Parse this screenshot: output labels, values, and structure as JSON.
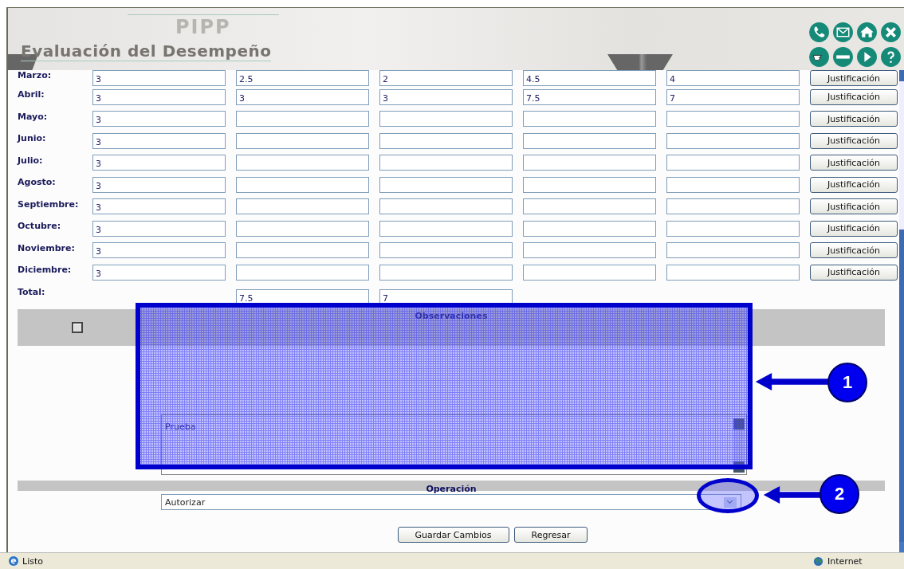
{
  "header": {
    "title": "Evaluación del Desempeño",
    "logo_text": "PIPP"
  },
  "months": [
    {
      "label": "Marzo:",
      "cells": [
        {
          "value": "3"
        },
        {
          "value": "2.5"
        },
        {
          "value": "2"
        },
        {
          "value": "4.5"
        },
        {
          "value": "4"
        }
      ],
      "button": "Justificación"
    },
    {
      "label": "Abril:",
      "cells": [
        {
          "value": "3"
        },
        {
          "value": "3"
        },
        {
          "value": "3"
        },
        {
          "value": "7.5"
        },
        {
          "value": "7"
        }
      ],
      "button": "Justificación"
    },
    {
      "label": "Mayo:",
      "cells": [
        {
          "value": "3"
        },
        {},
        {},
        {},
        {}
      ],
      "button": "Justificación"
    },
    {
      "label": "Junio:",
      "cells": [
        {
          "value": "3"
        },
        {},
        {},
        {},
        {}
      ],
      "button": "Justificación"
    },
    {
      "label": "Julio:",
      "cells": [
        {
          "value": "3"
        },
        {},
        {},
        {},
        {}
      ],
      "button": "Justificación"
    },
    {
      "label": "Agosto:",
      "cells": [
        {
          "value": "3"
        },
        {},
        {},
        {},
        {}
      ],
      "button": "Justificación"
    },
    {
      "label": "Septiembre:",
      "cells": [
        {
          "value": "3"
        },
        {},
        {},
        {},
        {}
      ],
      "button": "Justificación"
    },
    {
      "label": "Octubre:",
      "cells": [
        {
          "value": "3"
        },
        {},
        {},
        {},
        {}
      ],
      "button": "Justificación"
    },
    {
      "label": "Noviembre:",
      "cells": [
        {
          "value": "3"
        },
        {},
        {},
        {},
        {}
      ],
      "button": "Justificación"
    },
    {
      "label": "Diciembre:",
      "cells": [
        {
          "value": "3"
        },
        {},
        {},
        {},
        {}
      ],
      "button": "Justificación"
    }
  ],
  "total": {
    "label": "Total:",
    "cells": [
      {
        "kind": "blank"
      },
      {
        "kind": "field",
        "value": "7.5"
      },
      {
        "kind": "field",
        "value": "7"
      }
    ]
  },
  "observaciones": {
    "title": "Observaciones",
    "value": "Prueba"
  },
  "operacion": {
    "title": "Operación",
    "value": "Autorizar"
  },
  "buttons": [
    "Guardar Cambios",
    "Regresar"
  ],
  "callouts": [
    "1",
    "2"
  ],
  "status_bar": {
    "text": "Listo",
    "zone": "Internet"
  }
}
